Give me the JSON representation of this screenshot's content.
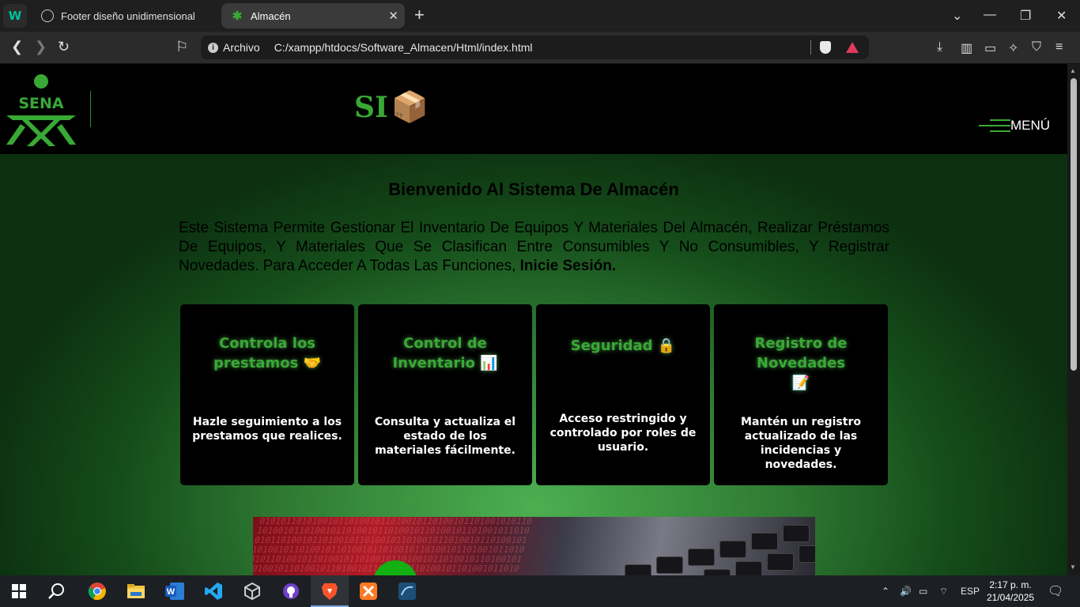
{
  "browser": {
    "tabs": [
      {
        "title": "Footer diseño unidimensional",
        "active": false
      },
      {
        "title": "Almacén",
        "active": true
      }
    ],
    "url_scheme": "Archivo",
    "url": "C:/xampp/htdocs/Software_Almacen/Html/index.html"
  },
  "header": {
    "sena_logo_text": "SENA",
    "system_logo_text": "SI",
    "system_logo_icon": "📦",
    "menu_label": "MENÚ"
  },
  "welcome": {
    "title": "Bienvenido Al Sistema De Almacén",
    "intro": "Este Sistema Permite Gestionar El Inventario De Equipos Y Materiales Del Almacén, Realizar Préstamos De Equipos, Y Materiales Que Se Clasifican Entre Consumibles Y No Consumibles, Y Registrar Novedades. Para Acceder A Todas Las Funciones, ",
    "intro_strong": "Inicie Sesión."
  },
  "cards": [
    {
      "title": "Controla los prestamos 🤝",
      "description": "Hazle seguimiento a los prestamos que realices."
    },
    {
      "title": "Control de Inventario 📊",
      "description": "Consulta y actualiza el estado de los materiales fácilmente."
    },
    {
      "title": "Seguridad 🔒",
      "description": "Acceso restringido y controlado por roles de usuario."
    },
    {
      "title": "Registro de Novedades 📝",
      "description": "Mantén un registro actualizado de las incidencias y novedades."
    }
  ],
  "taskbar": {
    "language": "ESP",
    "time": "2:17 p. m.",
    "date": "21/04/2025"
  },
  "colors": {
    "brand_green": "#39a935",
    "header_bg": "#000000",
    "card_bg": "#000000"
  }
}
